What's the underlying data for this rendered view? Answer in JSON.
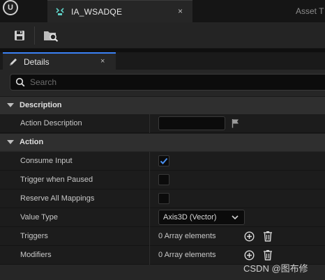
{
  "window": {
    "logo_glyph": "U",
    "tab_title": "IA_WSADQE",
    "tab_close": "×",
    "trailing_tab": "Asset T"
  },
  "toolbar": {
    "buttons": [
      {
        "icon": "save-icon"
      },
      {
        "icon": "browse-in-content-browser-icon"
      }
    ]
  },
  "details": {
    "tab_label": "Details",
    "tab_close": "×",
    "search_placeholder": "Search",
    "categories": [
      {
        "label": "Description",
        "properties": [
          {
            "name": "Action Description",
            "value": ""
          }
        ]
      },
      {
        "label": "Action",
        "properties": [
          {
            "name": "Consume Input",
            "checked": true
          },
          {
            "name": "Trigger when Paused",
            "checked": false
          },
          {
            "name": "Reserve All Mappings",
            "checked": false
          },
          {
            "name": "Value Type",
            "value": "Axis3D (Vector)"
          },
          {
            "name": "Triggers",
            "value": "0 Array elements"
          },
          {
            "name": "Modifiers",
            "value": "0 Array elements"
          }
        ]
      }
    ]
  },
  "watermark": "CSDN @图布修",
  "colors": {
    "accent": "#3b82f6",
    "panel": "#262626",
    "row": "#1c1c1c",
    "category": "#2f2f2f"
  }
}
